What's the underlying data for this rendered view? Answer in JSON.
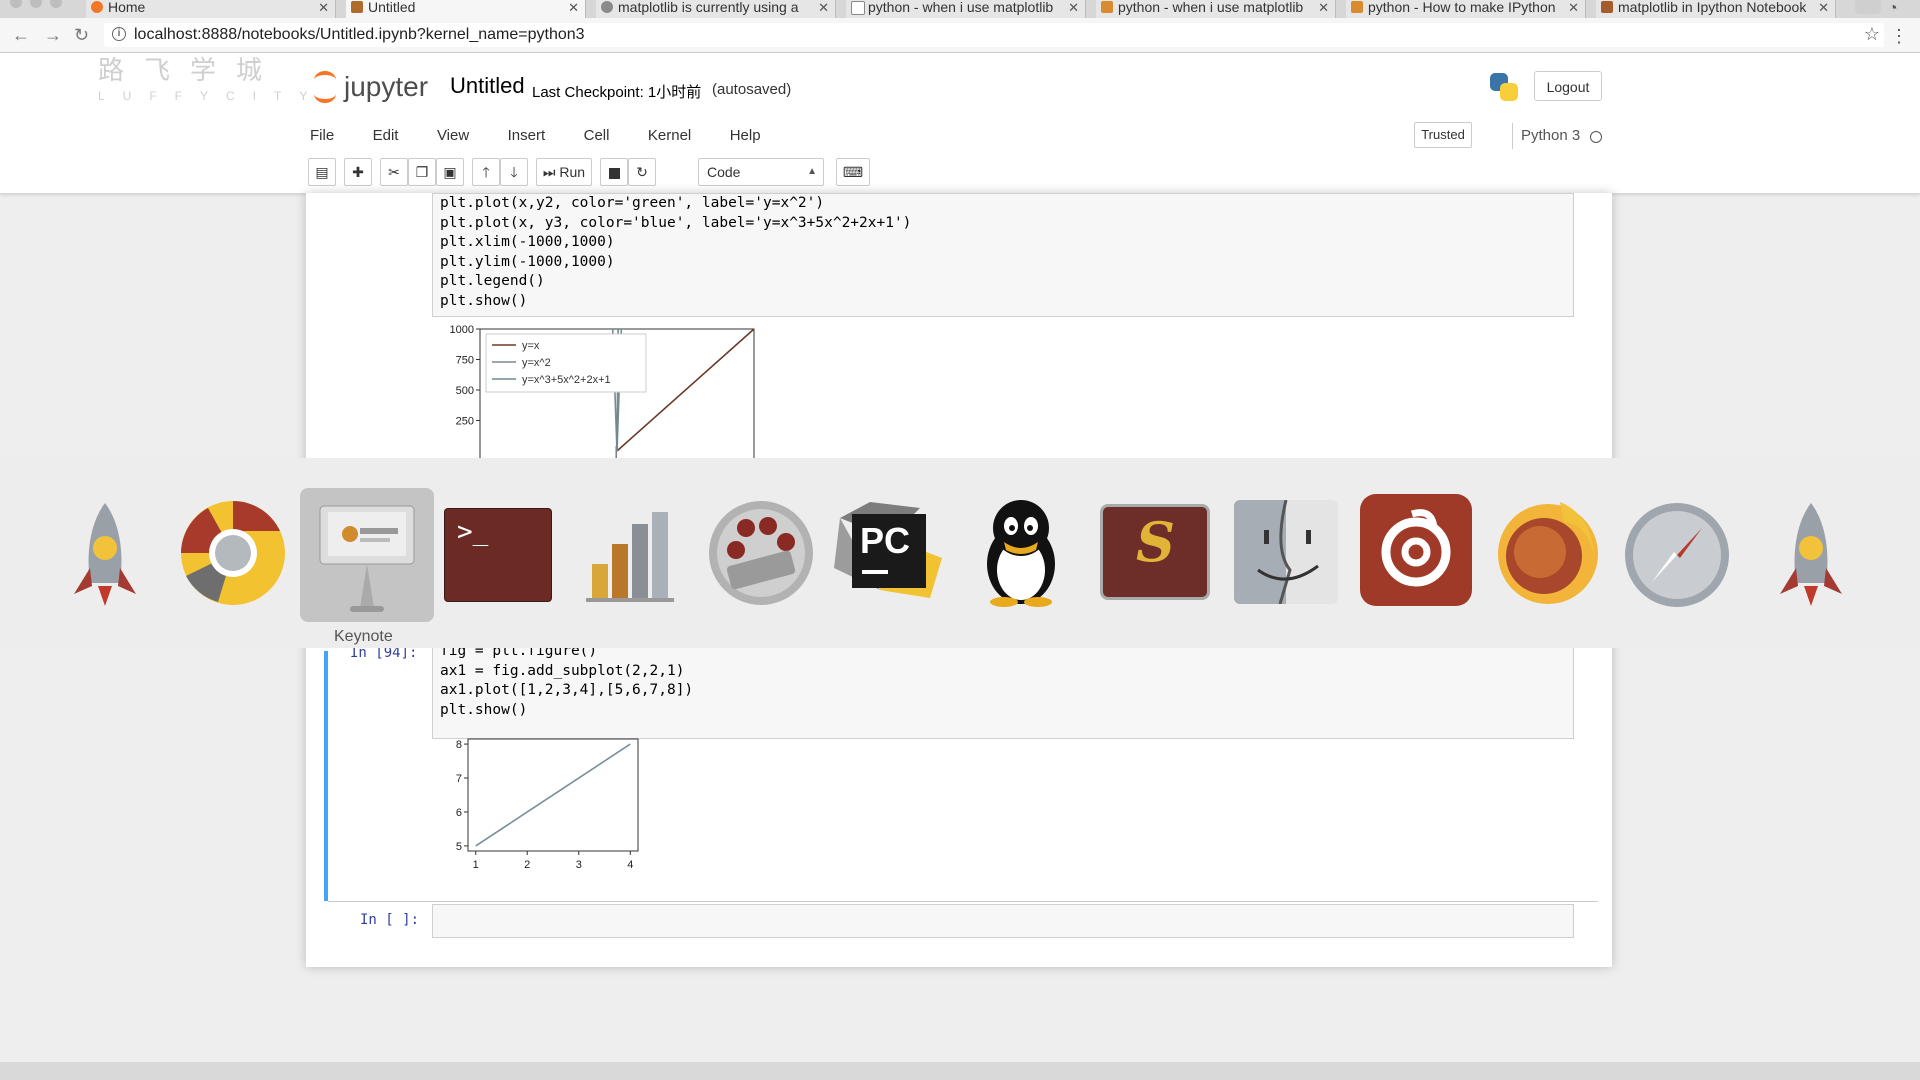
{
  "browser": {
    "tabs": [
      {
        "label": "Home",
        "active": false
      },
      {
        "label": "Untitled",
        "active": true
      },
      {
        "label": "matplotlib is currently using a",
        "active": false
      },
      {
        "label": "python - when i use matplotlib",
        "active": false
      },
      {
        "label": "python - when i use matplotlib",
        "active": false
      },
      {
        "label": "python - How to make IPython",
        "active": false
      },
      {
        "label": "matplotlib in Ipython Notebook",
        "active": false
      }
    ],
    "url": "localhost:8888/notebooks/Untitled.ipynb?kernel_name=python3"
  },
  "watermark": {
    "cn": "路飞学城",
    "en": "LUFFYCITY"
  },
  "jupyter": {
    "logo_text": "jupyter",
    "notebook_title": "Untitled",
    "checkpoint": "Last Checkpoint: 1小时前",
    "autosave": "(autosaved)",
    "logout_label": "Logout",
    "menu": [
      "File",
      "Edit",
      "View",
      "Insert",
      "Cell",
      "Kernel",
      "Help"
    ],
    "trusted_label": "Trusted",
    "kernel_name": "Python 3",
    "toolbar": {
      "run_label": "Run",
      "cell_type": "Code",
      "icons": [
        "save-icon",
        "plus-icon",
        "cut-icon",
        "copy-icon",
        "paste-icon",
        "arrow-up-icon",
        "arrow-down-icon",
        "run-icon",
        "stop-icon",
        "restart-icon",
        "keyboard-icon"
      ]
    }
  },
  "cells": {
    "cell1": {
      "code_lines": [
        "plt.plot(x,y2, color='green', label='y=x^2')",
        "plt.plot(x, y3, color='blue', label='y=x^3+5x^2+2x+1')",
        "plt.xlim(-1000,1000)",
        "plt.ylim(-1000,1000)",
        "plt.legend()",
        "plt.show()"
      ]
    },
    "cell2": {
      "prompt": "In [94]:",
      "code_lines": [
        "fig = plt.figure()",
        "ax1 = fig.add_subplot(2,2,1)",
        "ax1.plot([1,2,3,4],[5,6,7,8])",
        "plt.show()"
      ]
    },
    "cell3": {
      "prompt": "In [ ]:"
    }
  },
  "chart_data": [
    {
      "type": "line",
      "ylim": [
        -1000,
        1000
      ],
      "xlim": [
        -1000,
        1000
      ],
      "yticks_visible": [
        "1000",
        "750",
        "500",
        "250"
      ],
      "legend": [
        "y=x",
        "y=x^2",
        "y=x^3+5x^2+2x+1"
      ],
      "legend_position": "upper-left",
      "series": [
        {
          "name": "y=x",
          "x": [
            0,
            1000
          ],
          "y": [
            0,
            1000
          ]
        },
        {
          "name": "y=x^2",
          "x": [
            -31.6,
            0,
            31.6
          ],
          "y": [
            1000,
            0,
            1000
          ]
        },
        {
          "name": "y=x^3+5x^2+2x+1",
          "x": [
            -11.3,
            -5,
            0,
            8.3
          ],
          "y": [
            -1000,
            43,
            1,
            1000
          ]
        }
      ],
      "colors": {
        "y=x": "#6b3a28",
        "y=x^2": "#7a8a8e",
        "y=x^3+5x^2+2x+1": "#6f8891"
      }
    },
    {
      "type": "line",
      "x": [
        1,
        2,
        3,
        4
      ],
      "series": [
        {
          "values": [
            5,
            6,
            7,
            8
          ]
        }
      ],
      "xticks": [
        "1",
        "2",
        "3",
        "4"
      ],
      "yticks": [
        "5",
        "6",
        "7",
        "8"
      ],
      "xlim": [
        0.85,
        4.15
      ],
      "ylim": [
        4.85,
        8.15
      ],
      "color": "#7a8f99"
    }
  ],
  "dock": {
    "tooltip": "Keynote",
    "apps": [
      "rocket-icon",
      "chrome-icon",
      "keynote-icon",
      "terminal-icon",
      "chart-app-icon",
      "photo-booth-icon",
      "pycharm-icon",
      "qq-icon",
      "sublime-icon",
      "finder-icon",
      "netease-music-icon",
      "firefox-icon",
      "safari-icon",
      "rocket-icon"
    ],
    "terminal_glyph": ">_",
    "pycharm_glyph": "PC",
    "sublime_glyph": "S"
  }
}
